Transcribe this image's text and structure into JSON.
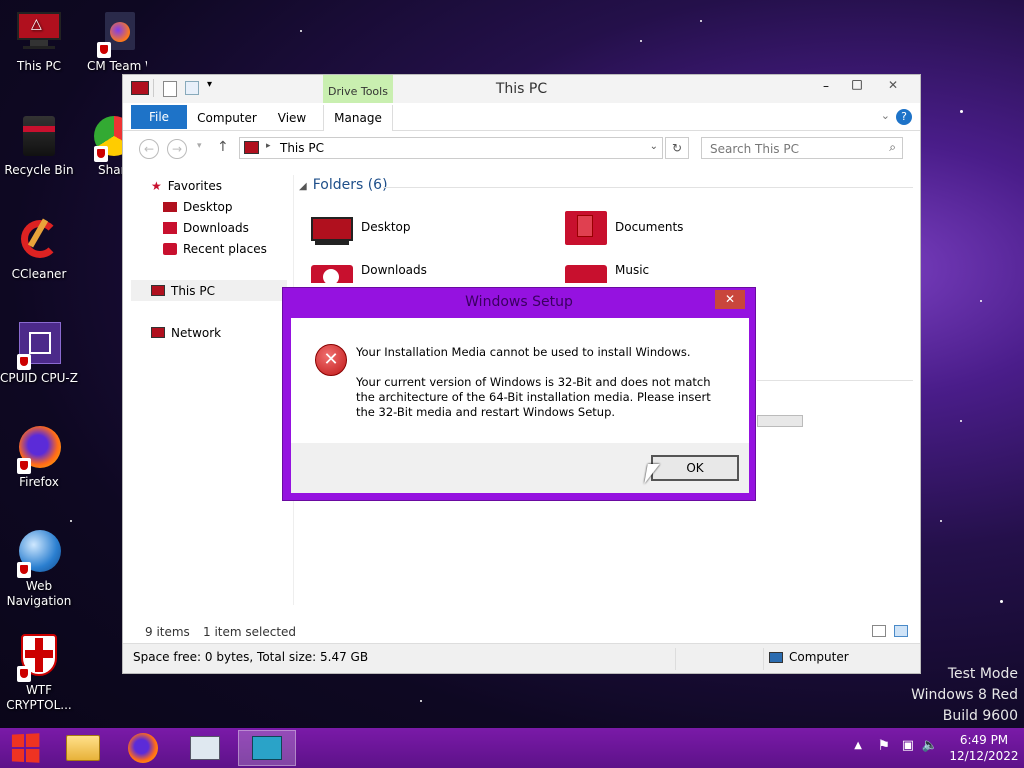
{
  "desktop": {
    "icons": [
      {
        "label": "This PC",
        "icon": "computer-icon"
      },
      {
        "label": "CM Team Webs",
        "icon": "firefox-shortcut-icon"
      },
      {
        "label": "Recycle Bin",
        "icon": "recycle-bin-icon"
      },
      {
        "label": "Shar",
        "icon": "chrome-shortcut-icon"
      },
      {
        "label": "CCleaner",
        "icon": "ccleaner-icon"
      },
      {
        "label": "CPUID CPU-Z",
        "icon": "cpuz-icon"
      },
      {
        "label": "Firefox",
        "icon": "firefox-icon"
      },
      {
        "label": "Web Navigation",
        "icon": "globe-icon"
      },
      {
        "label": "WTF CRYPTOL...",
        "icon": "shield-icon"
      }
    ],
    "watermark": [
      "Test Mode",
      "Windows 8 Red",
      "Build 9600"
    ]
  },
  "explorer": {
    "title": "This PC",
    "contextual_tab_group": "Drive Tools",
    "tabs": [
      "File",
      "Computer",
      "View",
      "Manage"
    ],
    "address": "This PC",
    "search_placeholder": "Search This PC",
    "sidebar": {
      "favorites": "Favorites",
      "favorites_items": [
        "Desktop",
        "Downloads",
        "Recent places"
      ],
      "this_pc": "This PC",
      "network": "Network"
    },
    "section_title": "Folders (6)",
    "folders": [
      "Desktop",
      "Documents",
      "Downloads",
      "Music"
    ],
    "status_items": "9 items",
    "status_selected": "1 item selected",
    "details_text": "Space free: 0 bytes, Total size: 5.47 GB",
    "details_location": "Computer"
  },
  "dialog": {
    "title": "Windows Setup",
    "close": "✕",
    "heading": "Your Installation Media cannot be used to install Windows.",
    "body": "Your current version of Windows is 32-Bit and does not match the architecture of the 64-Bit installation media. Please insert the 32-Bit media and restart Windows Setup.",
    "ok_label": "OK"
  },
  "taskbar": {
    "time": "6:49 PM",
    "date": "12/12/2022"
  },
  "colors": {
    "accent": "#9512e0",
    "taskbar": "#6b169a",
    "file_tab": "#1e73c8",
    "drive_tools": "#c9efb0",
    "folder_red": "#c8102e"
  }
}
